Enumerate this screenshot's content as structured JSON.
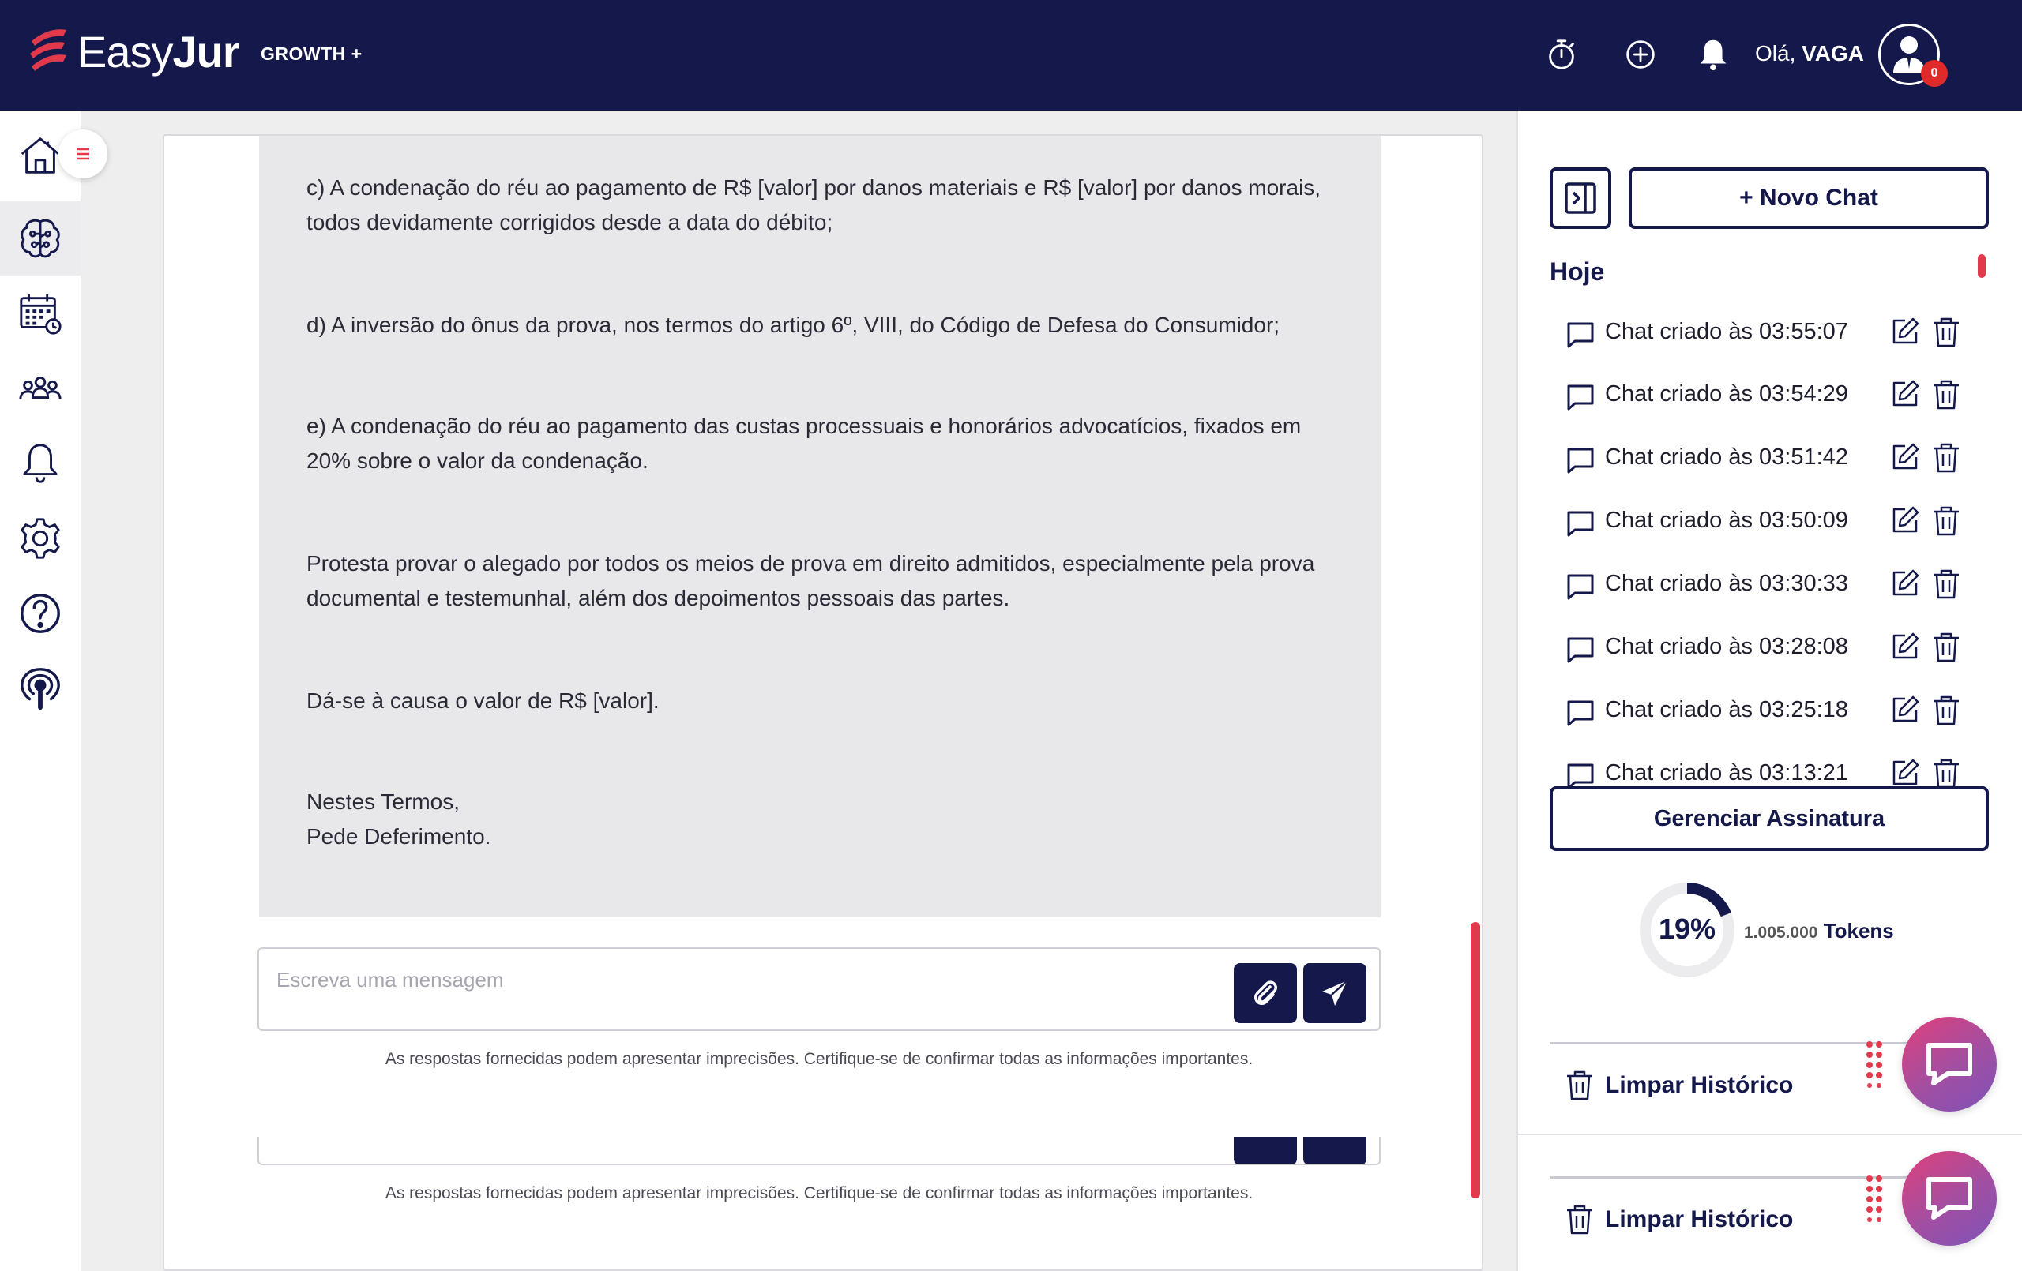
{
  "header": {
    "brand_light": "Easy",
    "brand_bold": "Jur",
    "plan": "GROWTH +",
    "greeting_prefix": "Olá, ",
    "greeting_name": "VAGA",
    "notification_count": "0",
    "icons": [
      "timer-icon",
      "plus-circle-icon",
      "bell-icon",
      "user-avatar-icon"
    ]
  },
  "nav": {
    "items": [
      {
        "name": "home",
        "icon": "home-icon"
      },
      {
        "name": "ai-brain",
        "icon": "brain-icon",
        "active": true
      },
      {
        "name": "calendar",
        "icon": "calendar-icon"
      },
      {
        "name": "team",
        "icon": "people-icon"
      },
      {
        "name": "notifications",
        "icon": "bell-icon"
      },
      {
        "name": "settings",
        "icon": "gear-icon"
      },
      {
        "name": "help",
        "icon": "help-icon"
      },
      {
        "name": "podcast",
        "icon": "podcast-icon"
      }
    ]
  },
  "message": {
    "paragraphs": [
      "c) A condenação do réu ao pagamento de R$ [valor] por danos materiais e R$ [valor] por danos morais, todos devidamente corrigidos desde a data do débito;",
      "d) A inversão do ônus da prova, nos termos do artigo 6º, VIII, do Código de Defesa do Consumidor;",
      "e) A condenação do réu ao pagamento das custas processuais e honorários advocatícios, fixados em 20% sobre o valor da condenação.",
      "Protesta provar o alegado por todos os meios de prova em direito admitidos, especialmente pela prova documental e testemunhal, além dos depoimentos pessoais das partes.",
      "Dá-se à causa o valor de R$ [valor].",
      "Nestes Termos,\nPede Deferimento."
    ]
  },
  "composer": {
    "placeholder": "Escreva uma mensagem",
    "value": "",
    "disclaimer": "As respostas fornecidas podem apresentar imprecisões. Certifique-se de confirmar todas as informações importantes."
  },
  "sidebar": {
    "new_chat_label": "+ Novo Chat",
    "section_label": "Hoje",
    "chats": [
      "Chat criado às 03:55:07",
      "Chat criado às 03:54:29",
      "Chat criado às 03:51:42",
      "Chat criado às 03:50:09",
      "Chat criado às 03:30:33",
      "Chat criado às 03:28:08",
      "Chat criado às 03:25:18",
      "Chat criado às 03:13:21"
    ],
    "manage_label": "Gerenciar Assinatura",
    "usage_percent": 19,
    "usage_label": "19%",
    "tokens_number": "1.005.000",
    "tokens_word": "Tokens",
    "clear_history_label": "Limpar Histórico"
  },
  "colors": {
    "navy": "#14184a",
    "accent_red": "#e13a4d",
    "chat_gradient_start": "#e0407a",
    "chat_gradient_end": "#7d52b7"
  }
}
